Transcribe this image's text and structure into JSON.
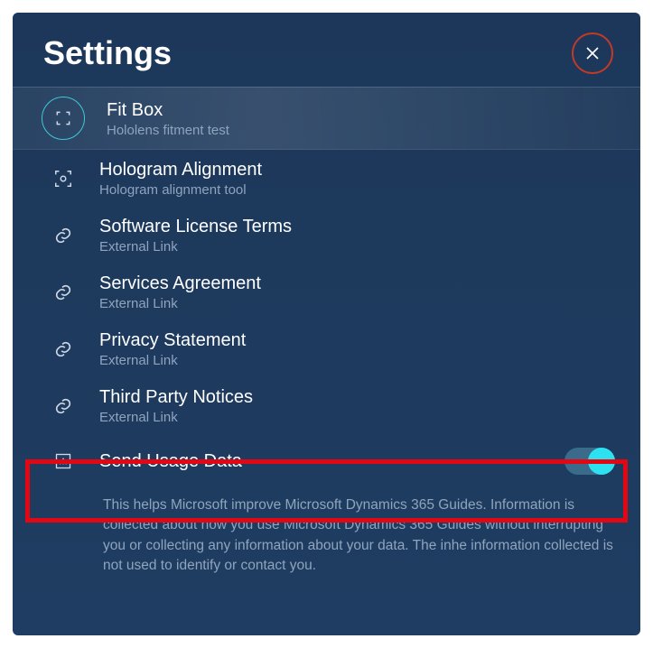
{
  "header": {
    "title": "Settings"
  },
  "items": [
    {
      "title": "Fit Box",
      "sub": "Hololens fitment test",
      "icon": "fitbox",
      "selected": true
    },
    {
      "title": "Hologram Alignment",
      "sub": "Hologram alignment tool",
      "icon": "align"
    },
    {
      "title": "Software License Terms",
      "sub": "External Link",
      "icon": "link"
    },
    {
      "title": "Services Agreement",
      "sub": "External Link",
      "icon": "link"
    },
    {
      "title": "Privacy Statement",
      "sub": "External Link",
      "icon": "link"
    },
    {
      "title": "Third Party Notices",
      "sub": "External Link",
      "icon": "link"
    }
  ],
  "toggle": {
    "label": "Send Usage Data",
    "on": true
  },
  "description": "This helps Microsoft improve Microsoft Dynamics 365 Guides.  Information is collected about how you use Microsoft Dynamics 365 Guides without interrupting you or collecting any information about your data.  The inhe information collected is not used to identify or contact you."
}
